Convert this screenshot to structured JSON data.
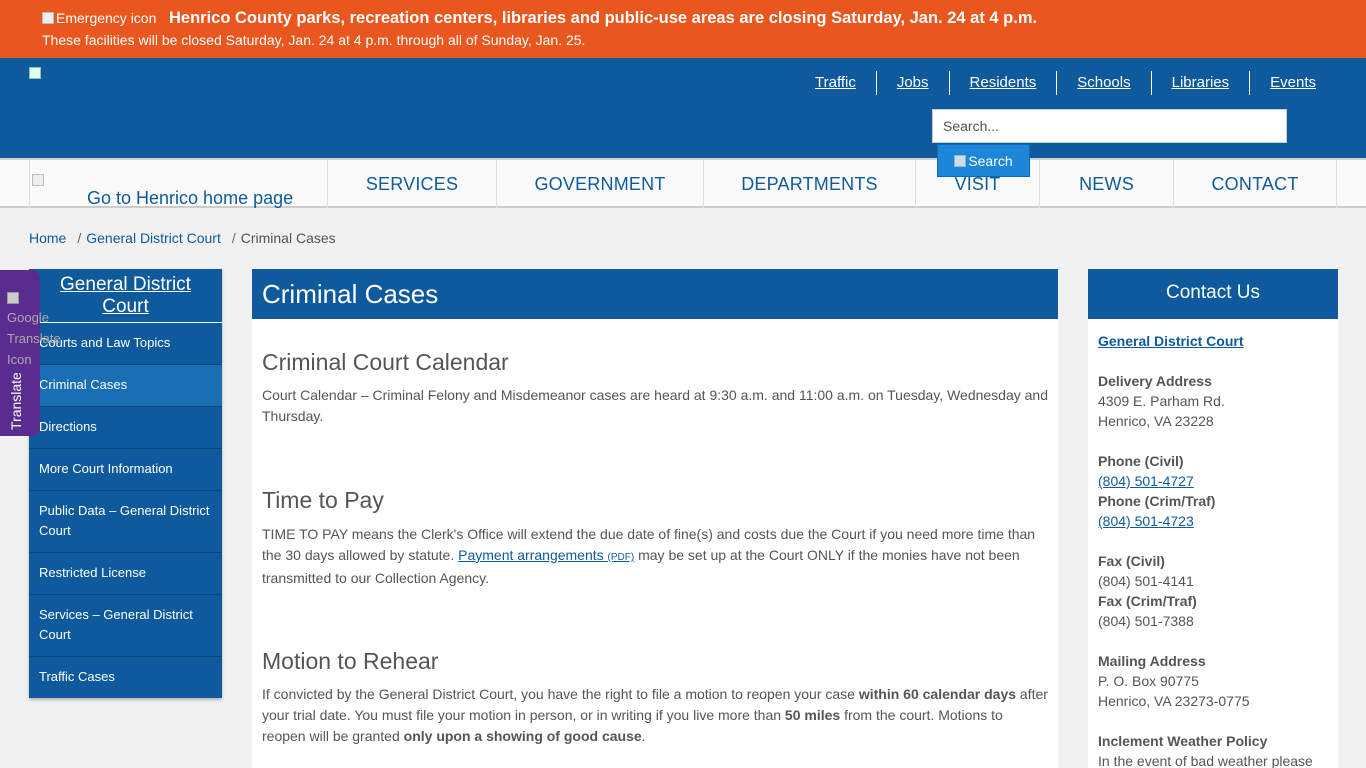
{
  "alert": {
    "icon_alt": "Emergency icon",
    "title": "Henrico County parks, recreation centers, libraries and public-use areas are closing Saturday, Jan. 24 at 4 p.m.",
    "subtitle": "These facilities will be closed Saturday, Jan. 24 at 4 p.m. through all of Sunday, Jan. 25."
  },
  "header": {
    "top_links": [
      "Traffic",
      "Jobs",
      "Residents",
      "Schools",
      "Libraries",
      "Events"
    ],
    "search_placeholder": "Search...",
    "search_button": "Search"
  },
  "nav": {
    "home_alt": "Go to Henrico home page",
    "items": [
      "SERVICES",
      "GOVERNMENT",
      "DEPARTMENTS",
      "VISIT",
      "NEWS",
      "CONTACT"
    ]
  },
  "breadcrumb": [
    "Home",
    "General District Court",
    "Criminal Cases"
  ],
  "translate": {
    "icon_alt": "Google Translate Icon",
    "label": "Translate"
  },
  "sidebar": {
    "title": "General District Court",
    "items": [
      "Courts and Law Topics",
      "Criminal Cases",
      "Directions",
      "More Court Information",
      "Public Data – General District Court",
      "Restricted License",
      "Services – General District Court",
      "Traffic Cases"
    ]
  },
  "main": {
    "title": "Criminal Cases",
    "s1_heading": "Criminal Court Calendar",
    "s1_text": "Court Calendar – Criminal Felony and Misdemeanor cases are heard at 9:30 a.m. and 11:00 a.m. on Tuesday, Wednesday and Thursday.",
    "s2_heading": "Time to Pay",
    "s2_text_a": "TIME TO PAY means the Clerk's Office will extend the due date of fine(s) and costs due the Court if you need more time than the 30 days allowed by statute. ",
    "s2_link": "Payment arrangements",
    "s2_pdf": "(PDF)",
    "s2_text_b": " may be set up at the Court ONLY if the monies have not been transmitted to our Collection Agency.",
    "s3_heading": "Motion to Rehear",
    "s3_a": "If convicted by the General District Court, you have the right to file a motion to reopen your case ",
    "s3_b": "within 60 calendar days",
    "s3_c": " after your trial date. You must file your motion in person, or in writing if you live more than ",
    "s3_d": "50 miles",
    "s3_e": " from the court. Motions to reopen will be granted ",
    "s3_f": "only upon a showing of good cause",
    "s3_g": "."
  },
  "contact": {
    "title": "Contact Us",
    "org": "General District Court",
    "delivery_label": "Delivery Address",
    "delivery_1": "4309 E. Parham Rd.",
    "delivery_2": "Henrico, VA 23228",
    "phone_civil_label": "Phone (Civil)",
    "phone_civil": "(804) 501-4727",
    "phone_crim_label": "Phone (Crim/Traf)",
    "phone_crim": "(804) 501-4723",
    "fax_civil_label": "Fax (Civil)",
    "fax_civil": "(804) 501-4141",
    "fax_crim_label": "Fax (Crim/Traf)",
    "fax_crim": "(804) 501-7388",
    "mailing_label": "Mailing Address",
    "mailing_1": "P. O. Box 90775",
    "mailing_2": "Henrico, VA 23273-0775",
    "weather_label": "Inclement Weather Policy",
    "weather_text": "In the event of bad weather please"
  }
}
